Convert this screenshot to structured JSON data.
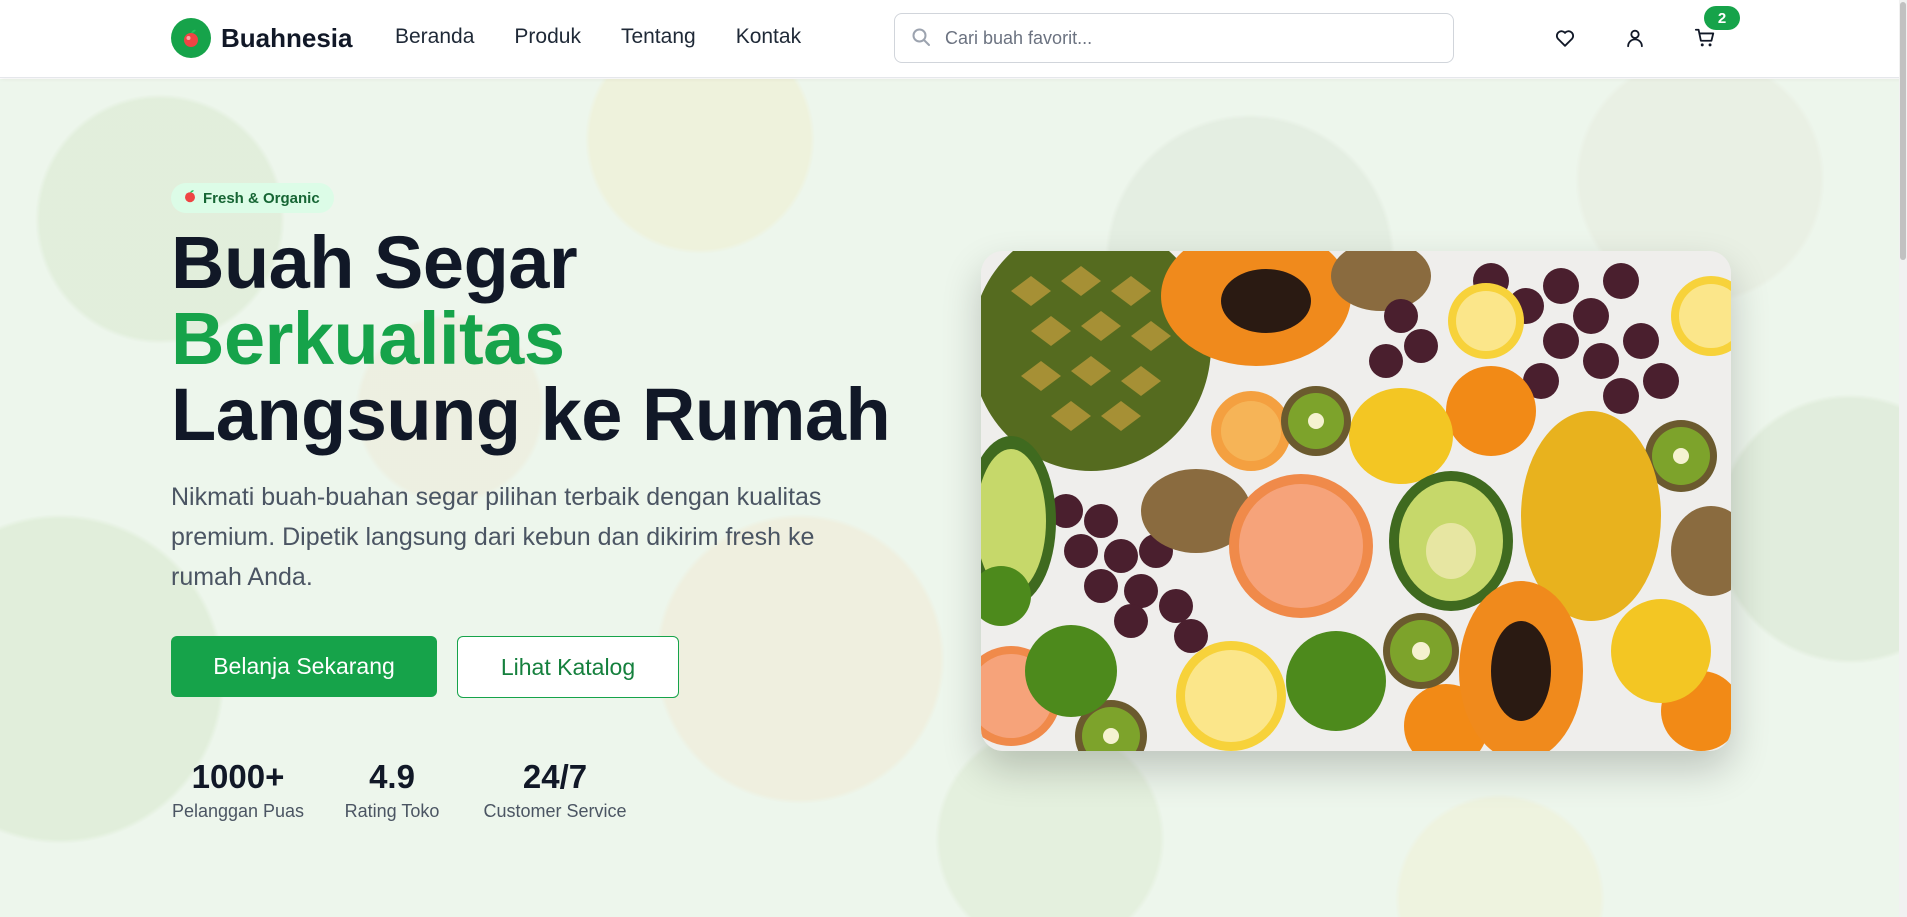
{
  "header": {
    "brand": "Buahnesia",
    "nav": [
      "Beranda",
      "Produk",
      "Tentang",
      "Kontak"
    ],
    "search_placeholder": "Cari buah favorit...",
    "cart_count": "2"
  },
  "hero": {
    "tag": "Fresh & Organic",
    "headline_line1": "Buah Segar",
    "headline_line2": "Berkualitas",
    "headline_line3": "Langsung ke Rumah",
    "description": "Nikmati buah-buahan segar pilihan terbaik dengan kualitas premium. Dipetik langsung dari kebun dan dikirim fresh ke rumah Anda.",
    "primary_button": "Belanja Sekarang",
    "secondary_button": "Lihat Katalog",
    "stats": [
      {
        "value": "1000+",
        "label": "Pelanggan Puas"
      },
      {
        "value": "4.9",
        "label": "Rating Toko"
      },
      {
        "value": "24/7",
        "label": "Customer Service"
      }
    ]
  },
  "colors": {
    "accent": "#16a34a",
    "text_dark": "#111827",
    "text_muted": "#4b5563",
    "tag_bg": "#dcfce7"
  },
  "icons": [
    "search-icon",
    "heart-icon",
    "user-icon",
    "cart-icon",
    "fruit-logo-icon"
  ]
}
